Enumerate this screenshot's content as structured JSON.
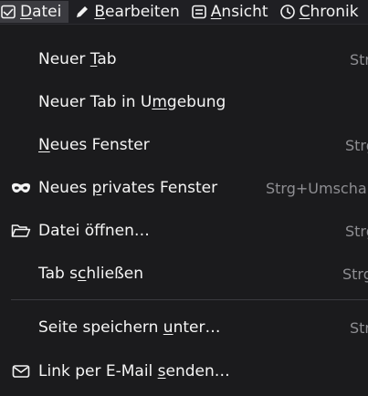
{
  "menubar": {
    "items": [
      {
        "label": "Datei",
        "icon": "file-icon",
        "active": true
      },
      {
        "label": "Bearbeiten",
        "icon": "pencil-icon",
        "active": false
      },
      {
        "label": "Ansicht",
        "icon": "view-icon",
        "active": false
      },
      {
        "label": "Chronik",
        "icon": "clock-icon",
        "active": false
      }
    ]
  },
  "file_menu": {
    "items": [
      {
        "label": "Neuer Tab",
        "underline_index": 6,
        "shortcut": "Strg+T",
        "icon": null
      },
      {
        "label": "Neuer Tab in Umgebung",
        "underline_index": 14,
        "shortcut": "",
        "icon": null
      },
      {
        "label": "Neues Fenster",
        "underline_index": 0,
        "shortcut": "Strg+N",
        "icon": null
      },
      {
        "label": "Neues privates Fenster",
        "underline_index": 6,
        "shortcut": "Strg+Umschalt+P",
        "icon": "private-mask-icon"
      },
      {
        "label": "Datei öffnen…",
        "underline_index": 8,
        "shortcut": "Strg+O",
        "icon": "folder-open-icon"
      },
      {
        "label": "Tab schließen",
        "underline_index": 5,
        "shortcut": "Strg+W",
        "icon": null
      },
      {
        "label": "Seite speichern unter…",
        "underline_index": 16,
        "shortcut": "Strg+S",
        "icon": null
      },
      {
        "label": "Link per E-Mail senden…",
        "underline_index": 16,
        "shortcut": "",
        "icon": "mail-icon"
      }
    ]
  },
  "colors": {
    "background": "#1b1b1d",
    "text": "#f5f5f5",
    "shortcut_text": "#8e8e92",
    "active_menubar_item": "#3b3b40",
    "separator": "#3a3a3f"
  }
}
